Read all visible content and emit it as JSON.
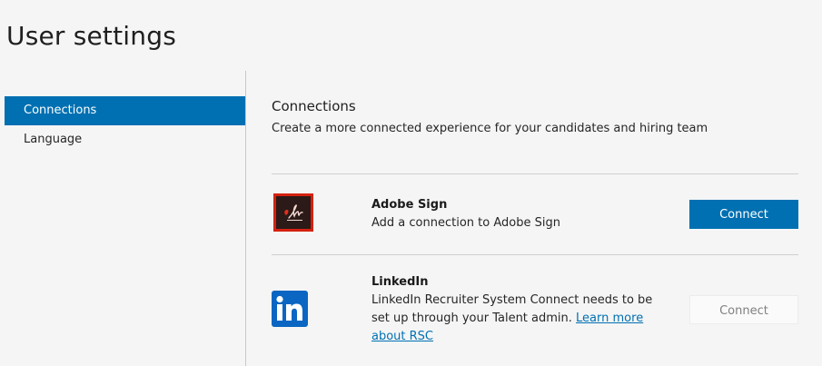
{
  "page": {
    "title": "User settings"
  },
  "sidebar": {
    "items": [
      {
        "label": "Connections",
        "active": true
      },
      {
        "label": "Language",
        "active": false
      }
    ]
  },
  "main": {
    "section_title": "Connections",
    "section_description": "Create a more connected experience for your candidates and hiring team",
    "connections": [
      {
        "name": "Adobe Sign",
        "icon": "adobe-sign-icon",
        "description": "Add a connection to Adobe Sign",
        "button_label": "Connect",
        "button_state": "enabled"
      },
      {
        "name": "LinkedIn",
        "icon": "linkedin-icon",
        "description": "LinkedIn Recruiter System Connect needs to be set up through your Talent admin.",
        "link_text": "Learn more about RSC",
        "button_label": "Connect",
        "button_state": "disabled"
      }
    ]
  },
  "colors": {
    "accent": "#0070b2",
    "adobe_red": "#d5210f",
    "linkedin_blue": "#0a66c2"
  }
}
